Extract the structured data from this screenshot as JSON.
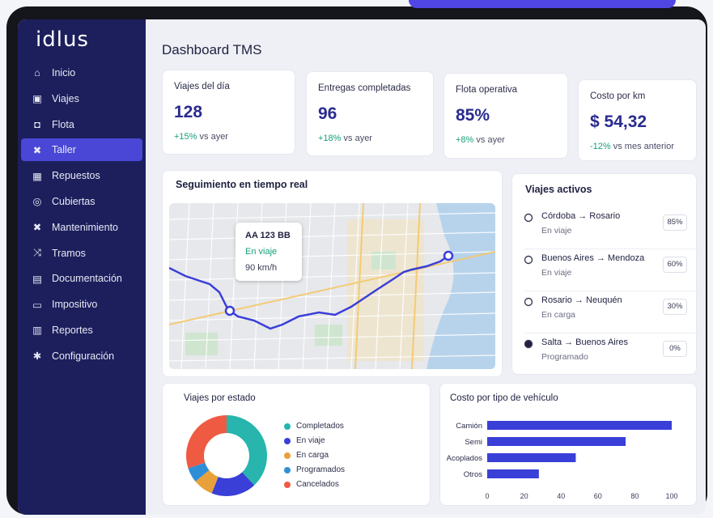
{
  "app": {
    "logo": "idlus",
    "page_title": "Dashboard TMS"
  },
  "sidebar": {
    "items": [
      {
        "label": "Inicio",
        "icon": "home-icon"
      },
      {
        "label": "Viajes",
        "icon": "bus-icon"
      },
      {
        "label": "Flota",
        "icon": "car-icon"
      },
      {
        "label": "Taller",
        "icon": "wrench-icon",
        "active": true
      },
      {
        "label": "Repuestos",
        "icon": "parts-icon"
      },
      {
        "label": "Cubiertas",
        "icon": "tire-icon"
      },
      {
        "label": "Mantenimiento",
        "icon": "tools-icon"
      },
      {
        "label": "Tramos",
        "icon": "route-icon"
      },
      {
        "label": "Documentación",
        "icon": "document-icon"
      },
      {
        "label": "Impositivo",
        "icon": "tax-icon"
      },
      {
        "label": "Reportes",
        "icon": "chart-icon"
      },
      {
        "label": "Configuración",
        "icon": "gear-icon"
      }
    ]
  },
  "kpis": [
    {
      "title": "Viajes del día",
      "value": "128",
      "delta": "+15%",
      "delta_text": "vs ayer",
      "trend": "up"
    },
    {
      "title": "Entregas completadas",
      "value": "96",
      "delta": "+18%",
      "delta_text": "vs ayer",
      "trend": "up"
    },
    {
      "title": "Flota operativa",
      "value": "85%",
      "delta": "+8%",
      "delta_text": "vs ayer",
      "trend": "up"
    },
    {
      "title": "Costo por km",
      "value": "$ 54,32",
      "delta": "-12%",
      "delta_text": "vs mes anterior",
      "trend": "down"
    }
  ],
  "tracking": {
    "title": "Seguimiento en tiempo real",
    "vehicle": {
      "plate": "AA 123 BB",
      "status": "En viaje",
      "speed": "90 km/h"
    }
  },
  "active_trips": {
    "title": "Viajes activos",
    "items": [
      {
        "route": "Córdoba → Rosario",
        "state": "En viaje",
        "progress": "85%"
      },
      {
        "route": "Buenos Aires → Mendoza",
        "state": "En viaje",
        "progress": "60%"
      },
      {
        "route": "Rosario → Neuquén",
        "state": "En carga",
        "progress": "30%"
      },
      {
        "route": "Salta → Buenos Aires",
        "state": "Programado",
        "progress": "0%"
      }
    ]
  },
  "trips_by_state": {
    "title": "Viajes por estado",
    "chart_data": {
      "type": "pie",
      "categories": [
        "Completados",
        "En viaje",
        "En carga",
        "Programados",
        "Cancelados"
      ],
      "values": [
        38,
        18,
        8,
        6,
        30
      ],
      "colors": [
        "#27b5ad",
        "#3a3fd8",
        "#e8a13a",
        "#2f8fd6",
        "#ef5a43"
      ]
    }
  },
  "cost_by_vehicle": {
    "title": "Costo por tipo de vehículo",
    "chart_data": {
      "type": "bar",
      "orientation": "horizontal",
      "categories": [
        "Camión",
        "Semi",
        "Acoplados",
        "Otros"
      ],
      "values": [
        100,
        75,
        48,
        28
      ],
      "xlim": [
        0,
        100
      ],
      "xticks": [
        "0",
        "20",
        "40",
        "60",
        "80",
        "100"
      ],
      "color": "#3a3fd8"
    }
  },
  "colors": {
    "sidebar": "#1c1f5c",
    "accent": "#4a47d6",
    "positive": "#16a07a",
    "negative": "#16a07a"
  }
}
